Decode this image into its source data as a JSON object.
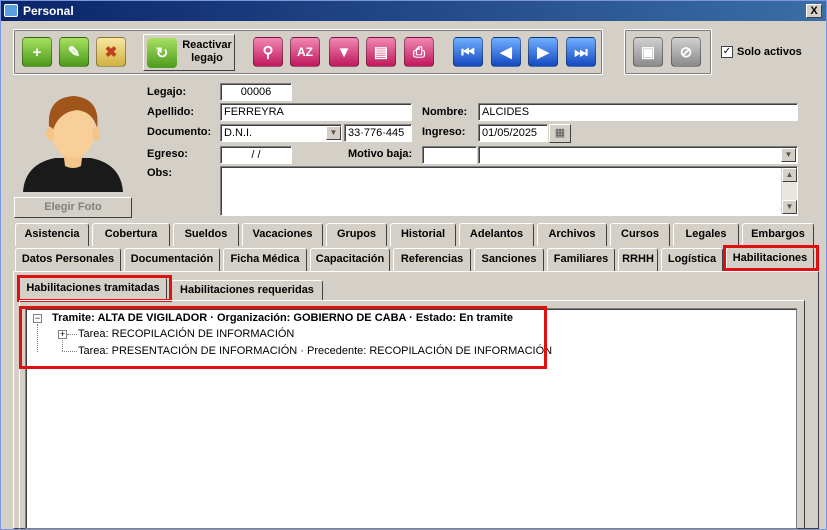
{
  "window": {
    "title": "Personal",
    "close_label": "X"
  },
  "toolbar": {
    "reactivar_label_1": "Reactivar",
    "reactivar_label_2": "legajo",
    "solo_activos_label": "Solo activos",
    "solo_activos_checked": "✓"
  },
  "photo": {
    "button_label": "Elegir Foto"
  },
  "form": {
    "legajo_label": "Legajo:",
    "legajo_value": "00006",
    "apellido_label": "Apellido:",
    "apellido_value": "FERREYRA",
    "nombre_label": "Nombre:",
    "nombre_value": "ALCIDES",
    "documento_label": "Documento:",
    "documento_tipo": "D.N.I.",
    "documento_numero": "33·776·445",
    "ingreso_label": "Ingreso:",
    "ingreso_value": "01/05/2025",
    "egreso_label": "Egreso:",
    "egreso_value": "  /  /",
    "motivo_baja_label": "Motivo baja:",
    "obs_label": "Obs:"
  },
  "tabs_row1": [
    "Asistencia",
    "Cobertura",
    "Sueldos",
    "Vacaciones",
    "Grupos",
    "Historial",
    "Adelantos",
    "Archivos",
    "Cursos",
    "Legales",
    "Embargos"
  ],
  "tabs_row2": [
    "Datos Personales",
    "Documentación",
    "Ficha Médica",
    "Capacitación",
    "Referencias",
    "Sanciones",
    "Familiares",
    "RRHH",
    "Logística",
    "Habilitaciones"
  ],
  "subtabs": [
    "Habilitaciones tramitadas",
    "Habilitaciones requeridas"
  ],
  "tree": {
    "root": "Tramite: ALTA DE VIGILADOR · Organización: GOBIERNO DE CABA · Estado: En tramite",
    "child1": "Tarea: RECOPILACIÓN DE INFORMACIÓN",
    "child2": "Tarea: PRESENTACIÓN DE INFORMACIÓN · Precedente: RECOPILACIÓN DE INFORMACIÓN"
  },
  "colors": {
    "highlight": "#e11010",
    "titlebar": "#0a246a"
  }
}
